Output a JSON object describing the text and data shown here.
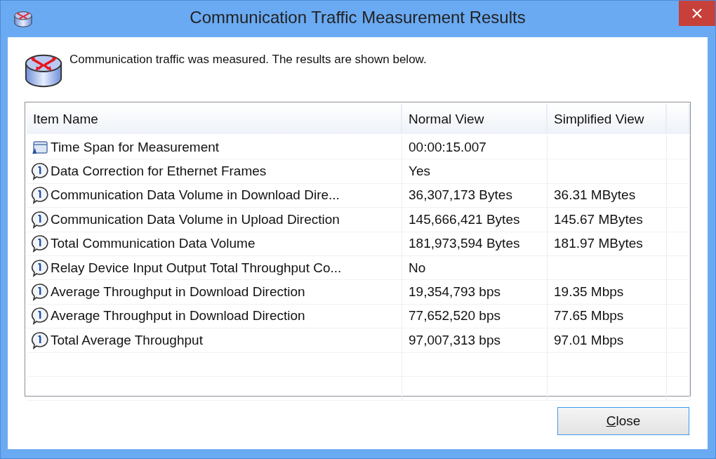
{
  "window": {
    "title": "Communication Traffic Measurement Results"
  },
  "message": "Communication traffic was measured. The results are shown below.",
  "table": {
    "columns": [
      "Item Name",
      "Normal View",
      "Simplified View"
    ],
    "rows": [
      {
        "kind": "clock",
        "name": "Time Span for Measurement",
        "normal": "00:00:15.007"
      },
      {
        "kind": "info",
        "name": "Data Correction for Ethernet Frames",
        "normal": "Yes"
      },
      {
        "kind": "info",
        "name": "Communication Data Volume in Download Dire...",
        "normal": "36,307,173 Bytes",
        "simplified": "36.31 MBytes"
      },
      {
        "kind": "info",
        "name": "Communication Data Volume in Upload Direction",
        "normal": "145,666,421 Bytes",
        "simplified": "145.67 MBytes"
      },
      {
        "kind": "info",
        "name": "Total Communication Data Volume",
        "normal": "181,973,594 Bytes",
        "simplified": "181.97 MBytes"
      },
      {
        "kind": "info",
        "name": "Relay Device Input Output Total Throughput Co...",
        "normal": "No"
      },
      {
        "kind": "info",
        "name": "Average Throughput in Download Direction",
        "normal": "19,354,793 bps",
        "simplified": "19.35 Mbps"
      },
      {
        "kind": "info",
        "name": "Average Throughput in Download Direction",
        "normal": "77,652,520 bps",
        "simplified": "77.65 Mbps"
      },
      {
        "kind": "info",
        "name": "Total Average Throughput",
        "normal": "97,007,313 bps",
        "simplified": "97.01 Mbps"
      }
    ]
  },
  "close_button": {
    "label": "Close"
  }
}
